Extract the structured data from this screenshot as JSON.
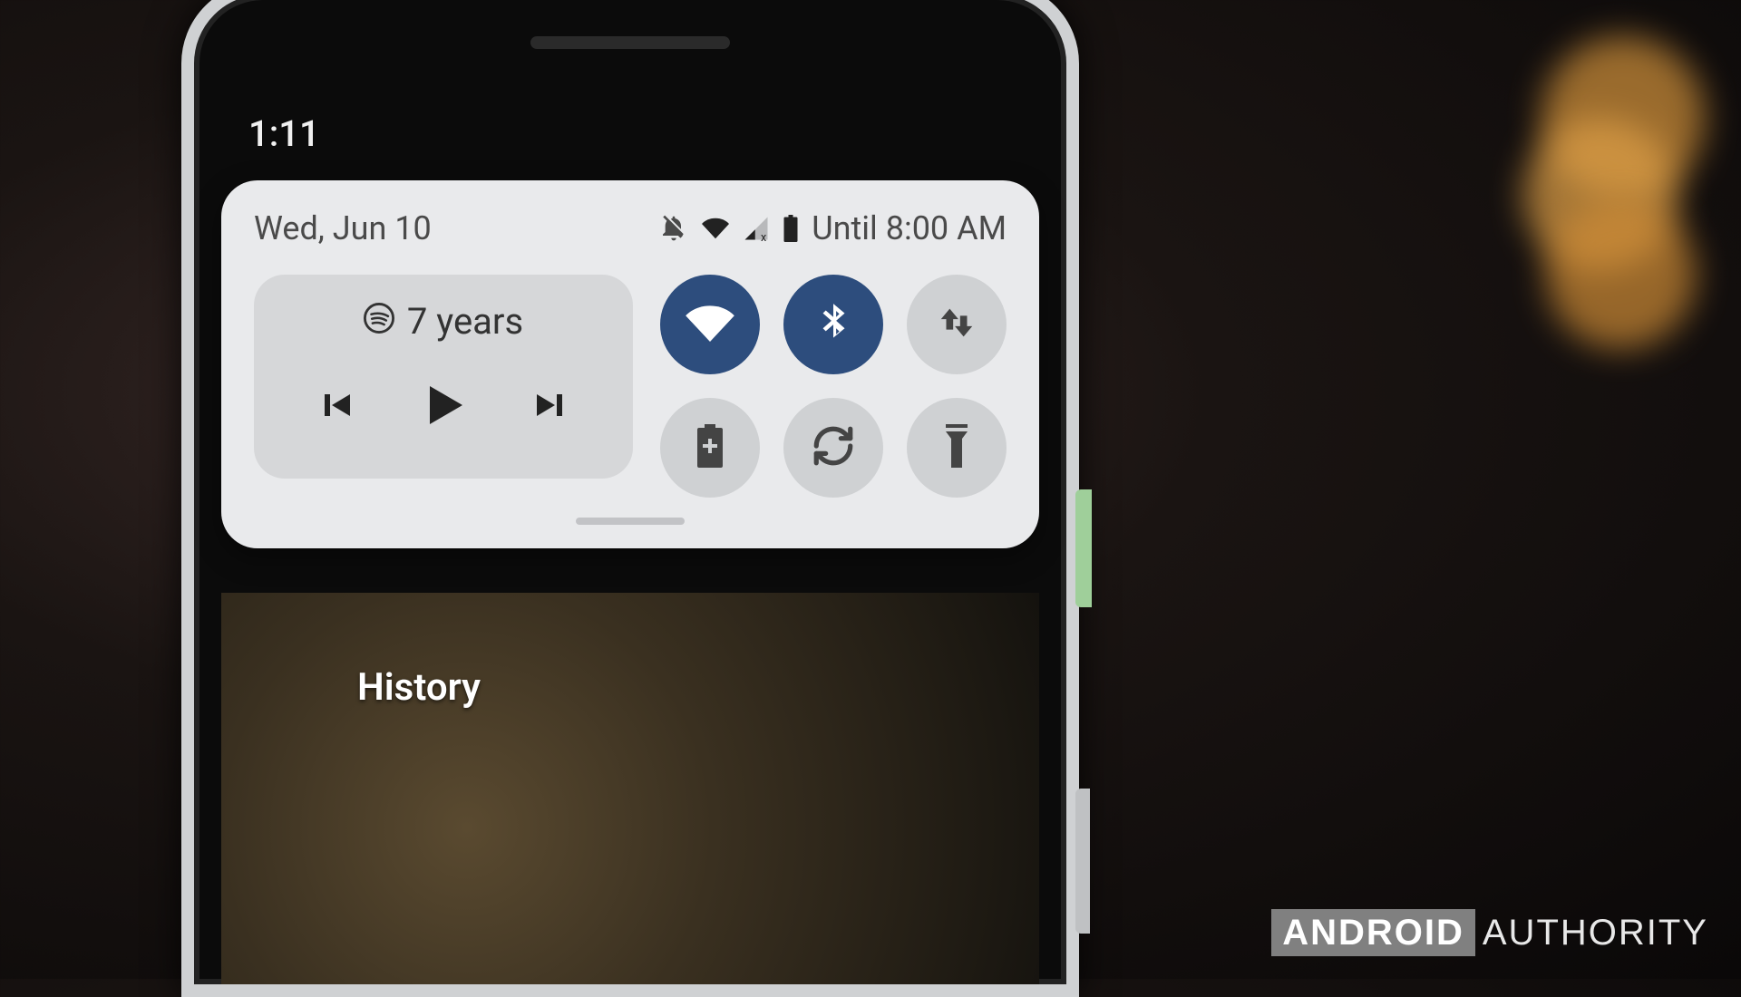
{
  "status": {
    "time": "1:11"
  },
  "panel": {
    "date": "Wed, Jun 10",
    "dnd_until": "Until 8:00 AM"
  },
  "media": {
    "app_icon": "spotify-icon",
    "track_title": "7 years"
  },
  "tiles": [
    {
      "name": "wifi",
      "icon": "wifi-icon",
      "active": true
    },
    {
      "name": "bluetooth",
      "icon": "bluetooth-icon",
      "active": true
    },
    {
      "name": "data",
      "icon": "data-arrows-icon",
      "active": false
    },
    {
      "name": "battery-saver",
      "icon": "battery-plus-icon",
      "active": false
    },
    {
      "name": "auto-rotate",
      "icon": "rotate-icon",
      "active": false
    },
    {
      "name": "flashlight",
      "icon": "flashlight-icon",
      "active": false
    }
  ],
  "homescreen": {
    "history_label": "History"
  },
  "watermark": {
    "brand_box": "ANDROID",
    "brand_rest": "AUTHORITY"
  },
  "colors": {
    "tile_active_bg": "#2d4d7d",
    "tile_inactive_bg": "#cfd1d3",
    "panel_bg": "#e9eaec"
  }
}
